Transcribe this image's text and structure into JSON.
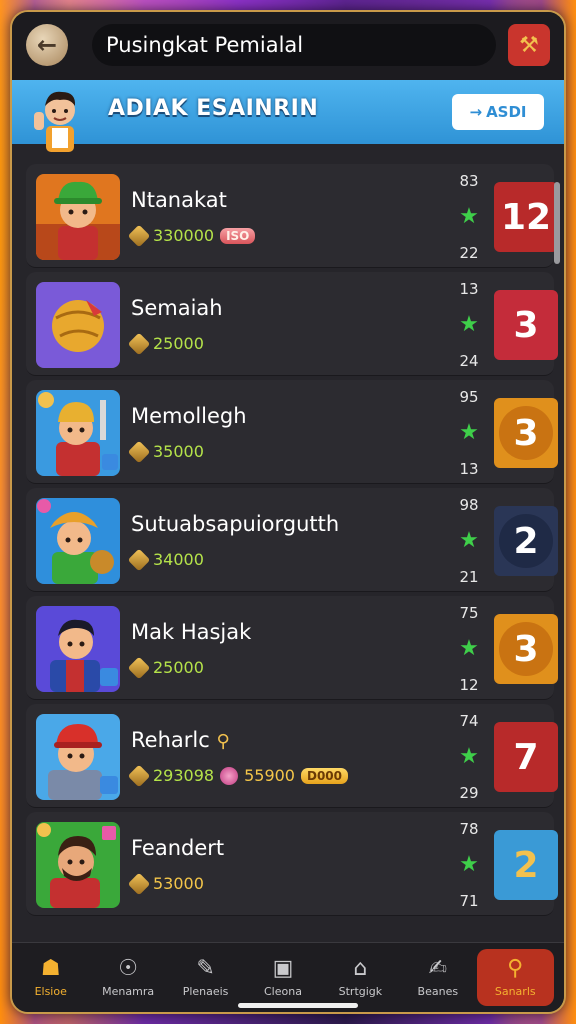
{
  "header": {
    "search_text": "Pusingkat Pemialal",
    "back_icon": "back-arrow-icon",
    "tools_icon": "tools-icon"
  },
  "banner": {
    "title": "ADIAK ESAINRIN",
    "button_label": "ASDI",
    "button_icon": "arrow-icon"
  },
  "colors": {
    "banner": "#3aa6e8",
    "accent": "#c99a4a",
    "coin_text": "#b5e34a",
    "star": "#3fcf4a"
  },
  "rows": [
    {
      "name": "Ntanakat",
      "coins": "330000",
      "extra": "",
      "tag": "ISO",
      "stat_top": "83",
      "stat_bottom": "22",
      "badge": "12",
      "badge_color": "#b82a2a",
      "thumb": "green-hat-character"
    },
    {
      "name": "Semaiah",
      "coins": "25000",
      "extra": "",
      "tag": "",
      "stat_top": "13",
      "stat_bottom": "24",
      "badge": "3",
      "badge_color": "#c42c3a",
      "thumb": "golden-ball"
    },
    {
      "name": "Memollegh",
      "coins": "35000",
      "extra": "",
      "tag": "",
      "stat_top": "95",
      "stat_bottom": "13",
      "badge": "3",
      "badge_color": "#d98a1a",
      "thumb": "miner-character"
    },
    {
      "name": "Sutuabsapuiorgutth",
      "coins": "34000",
      "extra": "",
      "tag": "",
      "stat_top": "98",
      "stat_bottom": "21",
      "badge": "2",
      "badge_color": "#2c3e66",
      "thumb": "cowboy-character"
    },
    {
      "name": "Mak Hasjak",
      "coins": "25000",
      "extra": "",
      "tag": "",
      "stat_top": "75",
      "stat_bottom": "12",
      "badge": "3",
      "badge_color": "#d98a1a",
      "thumb": "hero-character"
    },
    {
      "name": "Reharlc",
      "coins": "293098",
      "extra": "55900",
      "tag": "D000",
      "stat_top": "74",
      "stat_bottom": "29",
      "badge": "7",
      "badge_color": "#b82a2a",
      "thumb": "red-cap-character"
    },
    {
      "name": "Feandert",
      "coins": "53000",
      "extra": "",
      "tag": "",
      "stat_top": "78",
      "stat_bottom": "71",
      "badge": "2",
      "badge_color": "#3a9ad6",
      "thumb": "bearded-character"
    }
  ],
  "bottom_nav": [
    {
      "label": "Elsioe",
      "icon": "home-icon"
    },
    {
      "label": "Menamra",
      "icon": "compass-icon"
    },
    {
      "label": "Plenaeis",
      "icon": "pencil-icon"
    },
    {
      "label": "Cleona",
      "icon": "chat-icon"
    },
    {
      "label": "Strtgigk",
      "icon": "house-icon"
    },
    {
      "label": "Beanes",
      "icon": "edit-icon"
    },
    {
      "label": "Sanarls",
      "icon": "search-icon"
    }
  ]
}
